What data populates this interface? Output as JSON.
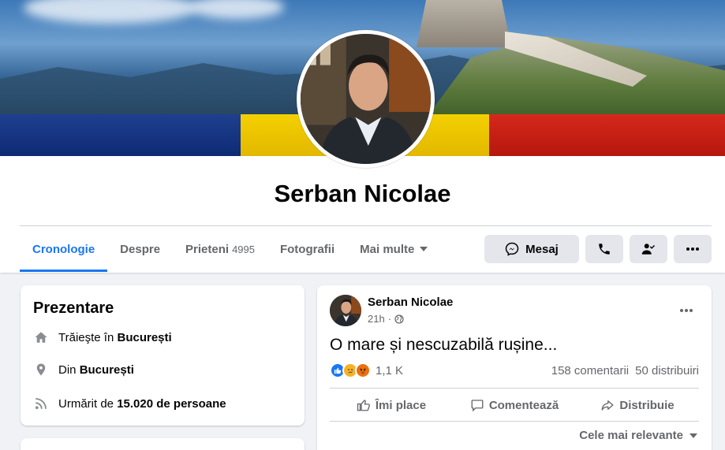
{
  "profile": {
    "name": "Serban Nicolae"
  },
  "tabs": [
    {
      "label": "Cronologie"
    },
    {
      "label": "Despre"
    },
    {
      "label": "Prieteni",
      "count": "4995"
    },
    {
      "label": "Fotografii"
    },
    {
      "label": "Mai multe"
    }
  ],
  "actions": {
    "message_label": "Mesaj"
  },
  "intro": {
    "title": "Prezentare",
    "lives_prefix": "Trăieşte în",
    "lives_city": "București",
    "from_prefix": "Din",
    "from_city": "București",
    "followed_prefix": "Urmărit de",
    "followed_count": "15.020 de persoane"
  },
  "post": {
    "author": "Serban Nicolae",
    "time": "21h",
    "text": "O mare și nescuzabilă rușine...",
    "reaction_count": "1,1 K",
    "comments": "158 comentarii",
    "shares": "50 distribuiri",
    "like_label": "Îmi place",
    "comment_label": "Comentează",
    "share_label": "Distribuie",
    "sort_label": "Cele mai relevante"
  },
  "colors": {
    "accent": "#1877f2",
    "flag_blue": "#0d2a74",
    "flag_yellow": "#f4d000",
    "flag_red": "#d6281c"
  }
}
